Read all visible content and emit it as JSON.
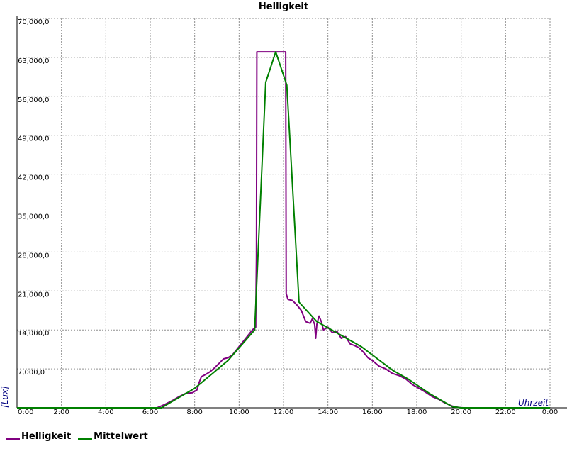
{
  "chart_data": {
    "type": "line",
    "title": "Helligkeit",
    "xlabel": "Uhrzeit",
    "ylabel": "[Lux]",
    "x_ticks": [
      "0:00",
      "2:00",
      "4:00",
      "6:00",
      "8:00",
      "10:00",
      "12:00",
      "14:00",
      "16:00",
      "18:00",
      "20:00",
      "22:00",
      "0:00"
    ],
    "y_ticks": [
      "0,00",
      "7,000,0",
      "14,000,0",
      "21,000,0",
      "28,000,0",
      "35,000,0",
      "42,000,0",
      "49,000,0",
      "56,000,0",
      "63,000,0",
      "70,000,0"
    ],
    "xlim": [
      0,
      24
    ],
    "ylim": [
      0,
      70000
    ],
    "grid": true,
    "legend_position": "bottom-left",
    "series": [
      {
        "name": "Helligkeit",
        "color": "#800080",
        "points": [
          [
            0,
            0
          ],
          [
            6.3,
            0
          ],
          [
            6.6,
            500
          ],
          [
            7.0,
            1300
          ],
          [
            7.3,
            2000
          ],
          [
            7.6,
            2600
          ],
          [
            7.9,
            2700
          ],
          [
            8.1,
            3200
          ],
          [
            8.2,
            4500
          ],
          [
            8.3,
            5600
          ],
          [
            8.5,
            6000
          ],
          [
            8.7,
            6500
          ],
          [
            8.9,
            7200
          ],
          [
            9.1,
            8000
          ],
          [
            9.3,
            8800
          ],
          [
            9.5,
            9000
          ],
          [
            9.7,
            9500
          ],
          [
            9.9,
            10500
          ],
          [
            10.0,
            11000
          ],
          [
            10.2,
            12000
          ],
          [
            10.4,
            13000
          ],
          [
            10.6,
            14000
          ],
          [
            10.75,
            14500
          ],
          [
            10.75,
            15500
          ],
          [
            10.78,
            27000
          ],
          [
            10.8,
            64000
          ],
          [
            12.1,
            64000
          ],
          [
            12.12,
            20500
          ],
          [
            12.2,
            19500
          ],
          [
            12.4,
            19300
          ],
          [
            12.6,
            18500
          ],
          [
            12.8,
            17500
          ],
          [
            13.0,
            15500
          ],
          [
            13.2,
            15200
          ],
          [
            13.3,
            16000
          ],
          [
            13.4,
            15000
          ],
          [
            13.45,
            12500
          ],
          [
            13.5,
            15000
          ],
          [
            13.6,
            16500
          ],
          [
            13.7,
            15500
          ],
          [
            13.8,
            14000
          ],
          [
            14.0,
            14500
          ],
          [
            14.2,
            13500
          ],
          [
            14.4,
            13800
          ],
          [
            14.6,
            12500
          ],
          [
            14.8,
            12800
          ],
          [
            15.0,
            11500
          ],
          [
            15.2,
            11200
          ],
          [
            15.4,
            10800
          ],
          [
            15.6,
            10000
          ],
          [
            15.8,
            9000
          ],
          [
            16.0,
            8500
          ],
          [
            16.3,
            7500
          ],
          [
            16.6,
            7000
          ],
          [
            16.9,
            6200
          ],
          [
            17.2,
            5800
          ],
          [
            17.5,
            5200
          ],
          [
            17.8,
            4200
          ],
          [
            18.1,
            3500
          ],
          [
            18.4,
            2800
          ],
          [
            18.7,
            2000
          ],
          [
            19.0,
            1500
          ],
          [
            19.3,
            800
          ],
          [
            19.6,
            300
          ],
          [
            19.9,
            50
          ],
          [
            20.1,
            0
          ],
          [
            24,
            0
          ]
        ]
      },
      {
        "name": "Mittelwert",
        "color": "#008000",
        "points": [
          [
            0,
            0
          ],
          [
            6.5,
            0
          ],
          [
            8.0,
            3500
          ],
          [
            9.5,
            8500
          ],
          [
            10.7,
            14000
          ],
          [
            11.2,
            58500
          ],
          [
            11.65,
            64000
          ],
          [
            12.15,
            58000
          ],
          [
            12.7,
            19000
          ],
          [
            13.5,
            15500
          ],
          [
            15.5,
            11000
          ],
          [
            16.9,
            6800
          ],
          [
            17.6,
            5200
          ],
          [
            18.6,
            2500
          ],
          [
            19.6,
            200
          ],
          [
            20.0,
            0
          ],
          [
            24,
            0
          ]
        ]
      }
    ]
  }
}
